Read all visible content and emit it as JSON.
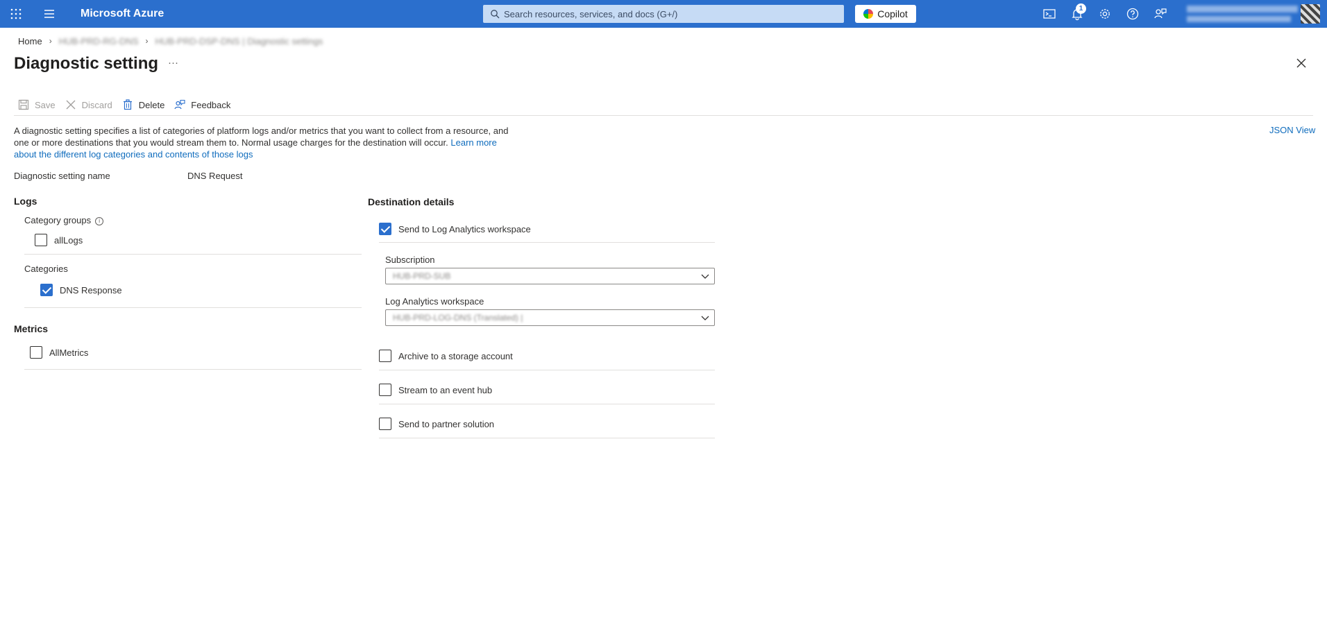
{
  "topbar": {
    "brand": "Microsoft Azure",
    "search_placeholder": "Search resources, services, and docs (G+/)",
    "copilot_label": "Copilot",
    "notification_count": "1",
    "account_line1": "███ ██████ ██████",
    "account_line2": "██████ ███████"
  },
  "breadcrumb": {
    "home": "Home",
    "item2": "HUB-PRD-RG-DNS",
    "item3": "HUB-PRD-DSP-DNS | Diagnostic settings"
  },
  "page": {
    "title": "Diagnostic setting",
    "ellipsis": "···"
  },
  "toolbar": {
    "save": "Save",
    "discard": "Discard",
    "delete": "Delete",
    "feedback": "Feedback"
  },
  "description": {
    "text": "A diagnostic setting specifies a list of categories of platform logs and/or metrics that you want to collect from a resource, and one or more destinations that you would stream them to. Normal usage charges for the destination will occur. ",
    "link": "Learn more about the different log categories and contents of those logs",
    "json_view": "JSON View"
  },
  "setting": {
    "name_label": "Diagnostic setting name",
    "name_value": "DNS Request"
  },
  "logs": {
    "title": "Logs",
    "category_groups_label": "Category groups",
    "all_logs": "allLogs",
    "all_logs_checked": false,
    "categories_label": "Categories",
    "dns_response": "DNS Response",
    "dns_response_checked": true
  },
  "metrics": {
    "title": "Metrics",
    "all_metrics": "AllMetrics",
    "all_metrics_checked": false
  },
  "destination": {
    "title": "Destination details",
    "log_analytics": "Send to Log Analytics workspace",
    "log_analytics_checked": true,
    "subscription_label": "Subscription",
    "subscription_value": "HUB-PRD-SUB",
    "workspace_label": "Log Analytics workspace",
    "workspace_value": "HUB-PRD-LOG-DNS (Translated) |",
    "archive": "Archive to a storage account",
    "archive_checked": false,
    "event_hub": "Stream to an event hub",
    "event_hub_checked": false,
    "partner": "Send to partner solution",
    "partner_checked": false
  },
  "colors": {
    "topbar": "#2b6fcd",
    "link": "#0f6cbd",
    "checked": "#2b6fcd"
  }
}
